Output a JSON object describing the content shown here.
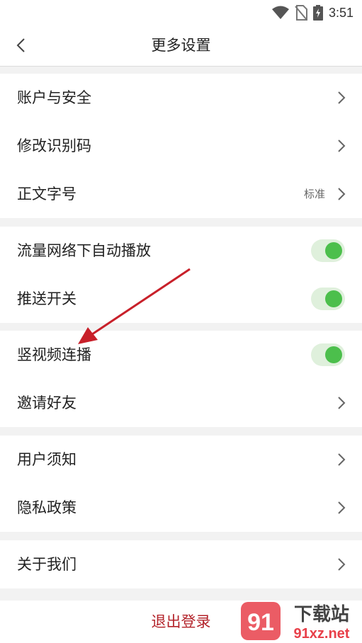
{
  "status_bar": {
    "time": "3:51"
  },
  "header": {
    "title": "更多设置"
  },
  "groups": [
    {
      "items": [
        {
          "label": "账户与安全"
        },
        {
          "label": "修改识别码"
        },
        {
          "label": "正文字号",
          "value": "标准"
        }
      ]
    },
    {
      "items": [
        {
          "label": "流量网络下自动播放",
          "toggle": true
        },
        {
          "label": "推送开关",
          "toggle": true
        }
      ]
    },
    {
      "items": [
        {
          "label": "竖视频连播",
          "toggle": true
        },
        {
          "label": "邀请好友"
        }
      ]
    },
    {
      "items": [
        {
          "label": "用户须知"
        },
        {
          "label": "隐私政策"
        }
      ]
    },
    {
      "items": [
        {
          "label": "关于我们"
        }
      ]
    }
  ],
  "logout": {
    "label": "退出登录"
  },
  "watermark": {
    "brand": "下载站",
    "domain": "91xz.net"
  },
  "colors": {
    "toggle_on": "#4cbf4c",
    "toggle_track": "#dff0dc",
    "logout": "#b3232a",
    "annotation_arrow": "#c8202a"
  }
}
